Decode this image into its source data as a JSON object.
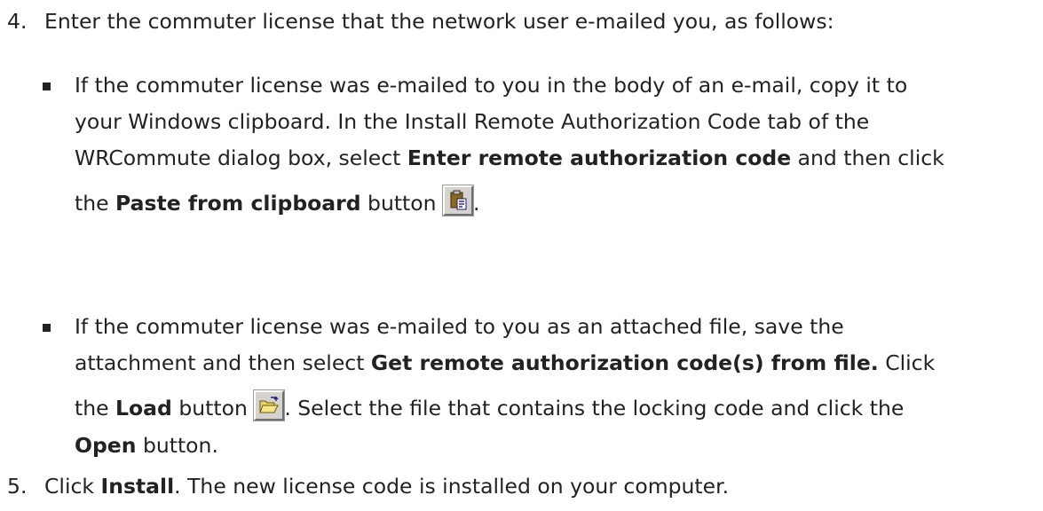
{
  "step4": {
    "number": "4.",
    "text": "Enter the commuter license that the network user e-mailed you, as follows:"
  },
  "bullet1": {
    "line1": "If the commuter license was e-mailed to you in the body of an e-mail, copy it to",
    "line2": "your Windows clipboard. In the Install Remote Authorization Code tab of the",
    "line3_a": "WRCommute dialog box, select ",
    "line3_bold": "Enter remote authorization code",
    "line3_b": " and then click",
    "line4_a": "the ",
    "line4_bold": "Paste from clipboard",
    "line4_b": " button ",
    "line4_c": ".",
    "button_icon": "paste-from-clipboard-icon"
  },
  "bullet2": {
    "line1": "If the commuter license was e-mailed to you as an attached file, save the",
    "line2_a": "attachment and then select ",
    "line2_bold": "Get remote authorization code(s) from file.",
    "line2_b": " Click",
    "line3_a": "the ",
    "line3_bold": "Load",
    "line3_b": " button ",
    "line3_c": ". Select the file that contains the locking code and click the",
    "line4_bold": "Open",
    "line4_b": " button.",
    "button_icon": "load-folder-icon"
  },
  "step5": {
    "number": "5.",
    "text_a": "Click ",
    "text_bold": "Install",
    "text_b": ". The new license code is installed on your computer."
  }
}
